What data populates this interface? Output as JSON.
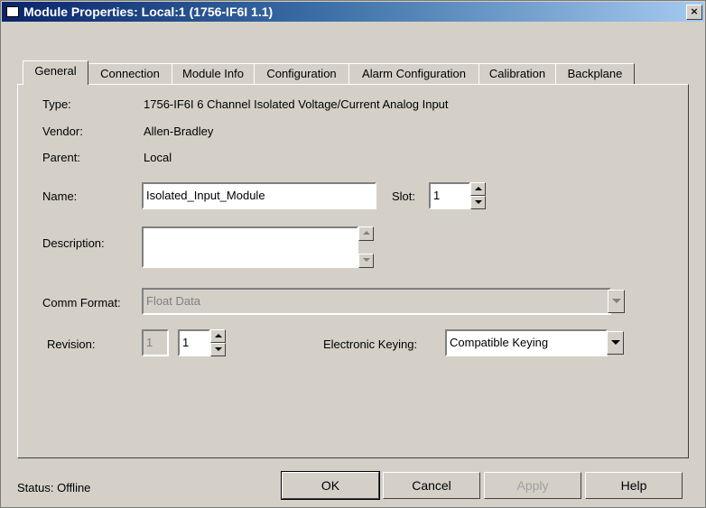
{
  "window": {
    "title": "Module Properties: Local:1 (1756-IF6I 1.1)",
    "close": "×"
  },
  "tabs": [
    "General",
    "Connection",
    "Module Info",
    "Configuration",
    "Alarm Configuration",
    "Calibration",
    "Backplane"
  ],
  "active_tab": "General",
  "general": {
    "type_label": "Type:",
    "type_value": "1756-IF6I 6 Channel Isolated Voltage/Current Analog Input",
    "vendor_label": "Vendor:",
    "vendor_value": "Allen-Bradley",
    "parent_label": "Parent:",
    "parent_value": "Local",
    "name_label": "Name:",
    "name_value": "Isolated_Input_Module",
    "slot_label": "Slot:",
    "slot_value": "1",
    "description_label": "Description:",
    "description_value": "",
    "comm_format_label": "Comm Format:",
    "comm_format_value": "Float Data",
    "revision_label": "Revision:",
    "revision_major": "1",
    "revision_minor": "1",
    "keying_label": "Electronic Keying:",
    "keying_value": "Compatible Keying"
  },
  "footer": {
    "status": "Status:  Offline",
    "ok": "OK",
    "cancel": "Cancel",
    "apply": "Apply",
    "help": "Help"
  }
}
